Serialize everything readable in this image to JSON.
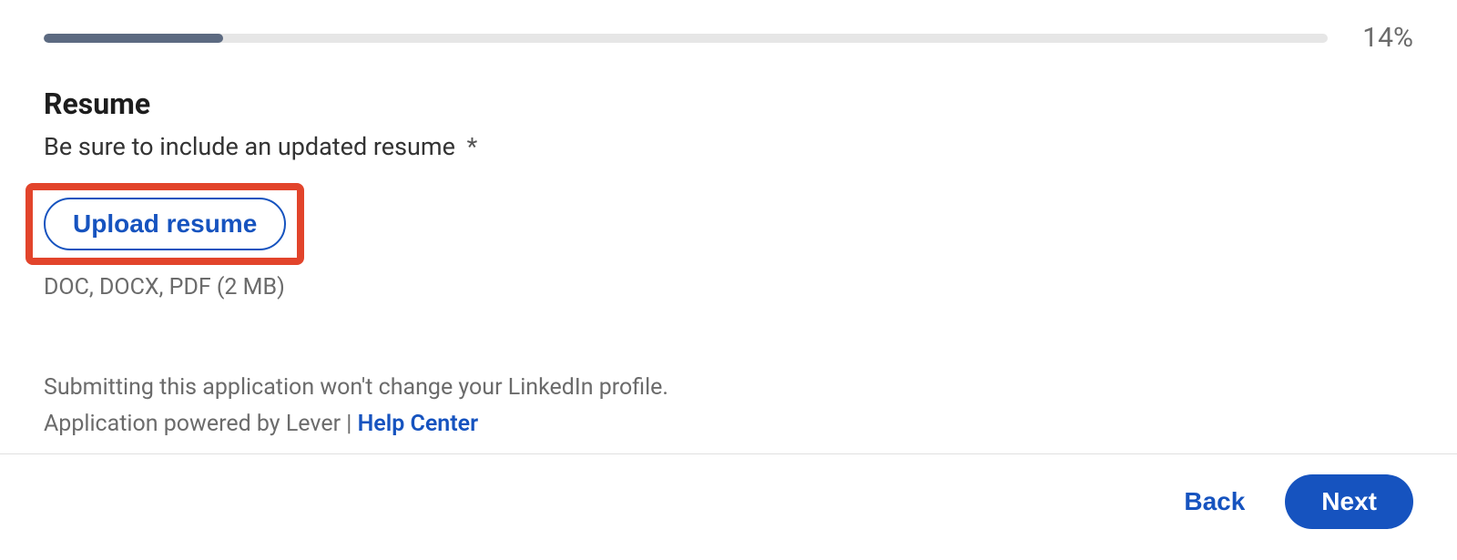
{
  "progress": {
    "percent": 14,
    "label": "14%"
  },
  "section": {
    "title": "Resume",
    "hint": "Be sure to include an updated resume",
    "required_marker": "*"
  },
  "upload": {
    "button_label": "Upload resume",
    "file_types": "DOC, DOCX, PDF (2 MB)"
  },
  "disclaimer": {
    "line1": "Submitting this application won't change your LinkedIn profile.",
    "line2_prefix": "Application powered by Lever | ",
    "help_link": "Help Center"
  },
  "footer": {
    "back_label": "Back",
    "next_label": "Next"
  }
}
